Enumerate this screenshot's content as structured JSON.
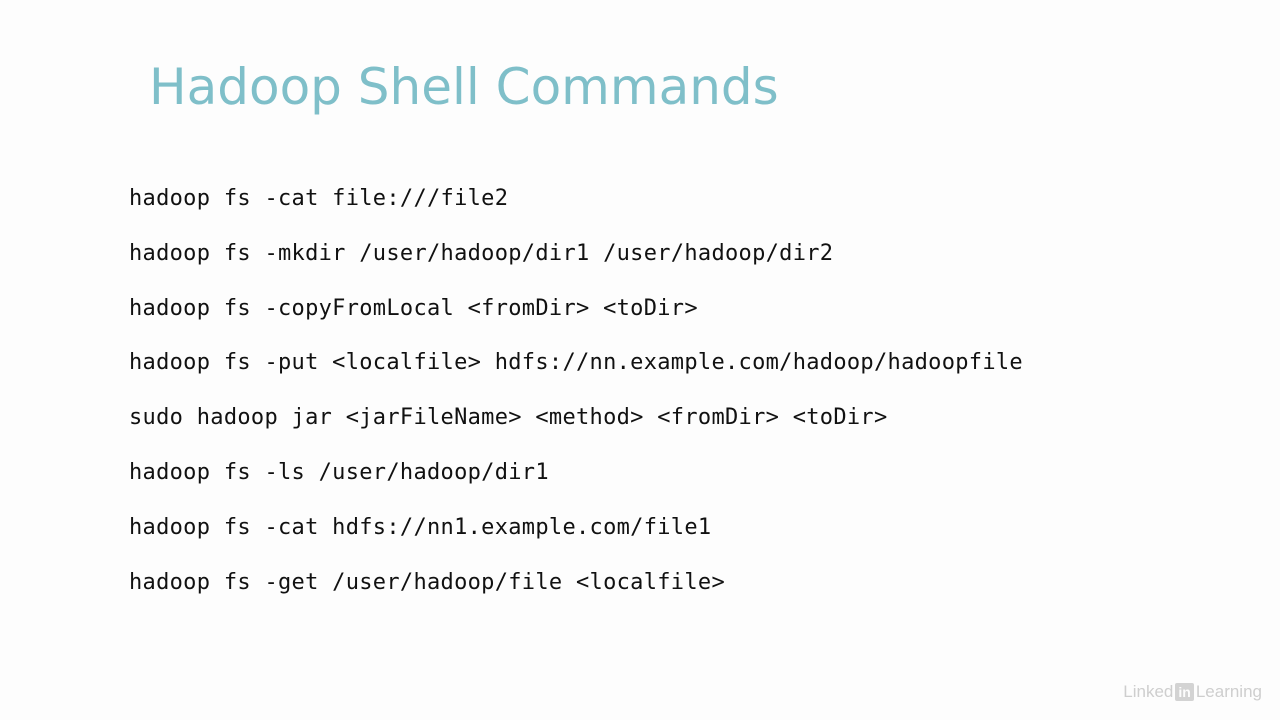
{
  "slide": {
    "title": "Hadoop Shell Commands",
    "commands": [
      "hadoop fs -cat file:///file2",
      "hadoop fs -mkdir /user/hadoop/dir1 /user/hadoop/dir2",
      "hadoop fs -copyFromLocal <fromDir> <toDir>",
      "hadoop fs -put <localfile> hdfs://nn.example.com/hadoop/hadoopfile",
      "sudo hadoop jar <jarFileName> <method> <fromDir> <toDir>",
      "hadoop fs -ls /user/hadoop/dir1",
      "hadoop fs -cat hdfs://nn1.example.com/file1",
      "hadoop fs -get /user/hadoop/file <localfile>"
    ]
  },
  "watermark": {
    "prefix": "Linked",
    "badge": "in",
    "suffix": "Learning"
  },
  "colors": {
    "title": "#7fbfc9",
    "text": "#111111",
    "background": "#fdfdfd"
  }
}
